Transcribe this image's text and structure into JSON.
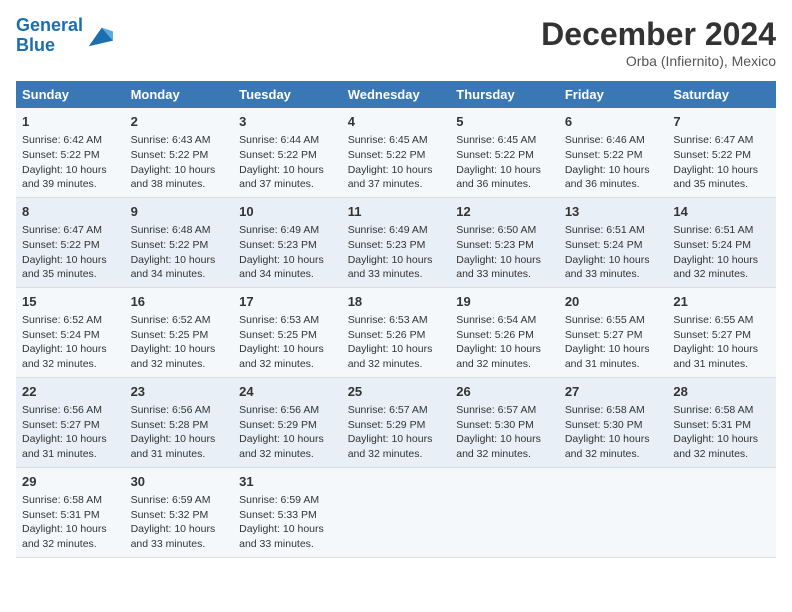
{
  "header": {
    "logo_line1": "General",
    "logo_line2": "Blue",
    "title": "December 2024",
    "location": "Orba (Infiernito), Mexico"
  },
  "days_of_week": [
    "Sunday",
    "Monday",
    "Tuesday",
    "Wednesday",
    "Thursday",
    "Friday",
    "Saturday"
  ],
  "weeks": [
    [
      {
        "day": 1,
        "lines": [
          "Sunrise: 6:42 AM",
          "Sunset: 5:22 PM",
          "Daylight: 10 hours",
          "and 39 minutes."
        ]
      },
      {
        "day": 2,
        "lines": [
          "Sunrise: 6:43 AM",
          "Sunset: 5:22 PM",
          "Daylight: 10 hours",
          "and 38 minutes."
        ]
      },
      {
        "day": 3,
        "lines": [
          "Sunrise: 6:44 AM",
          "Sunset: 5:22 PM",
          "Daylight: 10 hours",
          "and 37 minutes."
        ]
      },
      {
        "day": 4,
        "lines": [
          "Sunrise: 6:45 AM",
          "Sunset: 5:22 PM",
          "Daylight: 10 hours",
          "and 37 minutes."
        ]
      },
      {
        "day": 5,
        "lines": [
          "Sunrise: 6:45 AM",
          "Sunset: 5:22 PM",
          "Daylight: 10 hours",
          "and 36 minutes."
        ]
      },
      {
        "day": 6,
        "lines": [
          "Sunrise: 6:46 AM",
          "Sunset: 5:22 PM",
          "Daylight: 10 hours",
          "and 36 minutes."
        ]
      },
      {
        "day": 7,
        "lines": [
          "Sunrise: 6:47 AM",
          "Sunset: 5:22 PM",
          "Daylight: 10 hours",
          "and 35 minutes."
        ]
      }
    ],
    [
      {
        "day": 8,
        "lines": [
          "Sunrise: 6:47 AM",
          "Sunset: 5:22 PM",
          "Daylight: 10 hours",
          "and 35 minutes."
        ]
      },
      {
        "day": 9,
        "lines": [
          "Sunrise: 6:48 AM",
          "Sunset: 5:22 PM",
          "Daylight: 10 hours",
          "and 34 minutes."
        ]
      },
      {
        "day": 10,
        "lines": [
          "Sunrise: 6:49 AM",
          "Sunset: 5:23 PM",
          "Daylight: 10 hours",
          "and 34 minutes."
        ]
      },
      {
        "day": 11,
        "lines": [
          "Sunrise: 6:49 AM",
          "Sunset: 5:23 PM",
          "Daylight: 10 hours",
          "and 33 minutes."
        ]
      },
      {
        "day": 12,
        "lines": [
          "Sunrise: 6:50 AM",
          "Sunset: 5:23 PM",
          "Daylight: 10 hours",
          "and 33 minutes."
        ]
      },
      {
        "day": 13,
        "lines": [
          "Sunrise: 6:51 AM",
          "Sunset: 5:24 PM",
          "Daylight: 10 hours",
          "and 33 minutes."
        ]
      },
      {
        "day": 14,
        "lines": [
          "Sunrise: 6:51 AM",
          "Sunset: 5:24 PM",
          "Daylight: 10 hours",
          "and 32 minutes."
        ]
      }
    ],
    [
      {
        "day": 15,
        "lines": [
          "Sunrise: 6:52 AM",
          "Sunset: 5:24 PM",
          "Daylight: 10 hours",
          "and 32 minutes."
        ]
      },
      {
        "day": 16,
        "lines": [
          "Sunrise: 6:52 AM",
          "Sunset: 5:25 PM",
          "Daylight: 10 hours",
          "and 32 minutes."
        ]
      },
      {
        "day": 17,
        "lines": [
          "Sunrise: 6:53 AM",
          "Sunset: 5:25 PM",
          "Daylight: 10 hours",
          "and 32 minutes."
        ]
      },
      {
        "day": 18,
        "lines": [
          "Sunrise: 6:53 AM",
          "Sunset: 5:26 PM",
          "Daylight: 10 hours",
          "and 32 minutes."
        ]
      },
      {
        "day": 19,
        "lines": [
          "Sunrise: 6:54 AM",
          "Sunset: 5:26 PM",
          "Daylight: 10 hours",
          "and 32 minutes."
        ]
      },
      {
        "day": 20,
        "lines": [
          "Sunrise: 6:55 AM",
          "Sunset: 5:27 PM",
          "Daylight: 10 hours",
          "and 31 minutes."
        ]
      },
      {
        "day": 21,
        "lines": [
          "Sunrise: 6:55 AM",
          "Sunset: 5:27 PM",
          "Daylight: 10 hours",
          "and 31 minutes."
        ]
      }
    ],
    [
      {
        "day": 22,
        "lines": [
          "Sunrise: 6:56 AM",
          "Sunset: 5:27 PM",
          "Daylight: 10 hours",
          "and 31 minutes."
        ]
      },
      {
        "day": 23,
        "lines": [
          "Sunrise: 6:56 AM",
          "Sunset: 5:28 PM",
          "Daylight: 10 hours",
          "and 31 minutes."
        ]
      },
      {
        "day": 24,
        "lines": [
          "Sunrise: 6:56 AM",
          "Sunset: 5:29 PM",
          "Daylight: 10 hours",
          "and 32 minutes."
        ]
      },
      {
        "day": 25,
        "lines": [
          "Sunrise: 6:57 AM",
          "Sunset: 5:29 PM",
          "Daylight: 10 hours",
          "and 32 minutes."
        ]
      },
      {
        "day": 26,
        "lines": [
          "Sunrise: 6:57 AM",
          "Sunset: 5:30 PM",
          "Daylight: 10 hours",
          "and 32 minutes."
        ]
      },
      {
        "day": 27,
        "lines": [
          "Sunrise: 6:58 AM",
          "Sunset: 5:30 PM",
          "Daylight: 10 hours",
          "and 32 minutes."
        ]
      },
      {
        "day": 28,
        "lines": [
          "Sunrise: 6:58 AM",
          "Sunset: 5:31 PM",
          "Daylight: 10 hours",
          "and 32 minutes."
        ]
      }
    ],
    [
      {
        "day": 29,
        "lines": [
          "Sunrise: 6:58 AM",
          "Sunset: 5:31 PM",
          "Daylight: 10 hours",
          "and 32 minutes."
        ]
      },
      {
        "day": 30,
        "lines": [
          "Sunrise: 6:59 AM",
          "Sunset: 5:32 PM",
          "Daylight: 10 hours",
          "and 33 minutes."
        ]
      },
      {
        "day": 31,
        "lines": [
          "Sunrise: 6:59 AM",
          "Sunset: 5:33 PM",
          "Daylight: 10 hours",
          "and 33 minutes."
        ]
      },
      null,
      null,
      null,
      null
    ]
  ]
}
